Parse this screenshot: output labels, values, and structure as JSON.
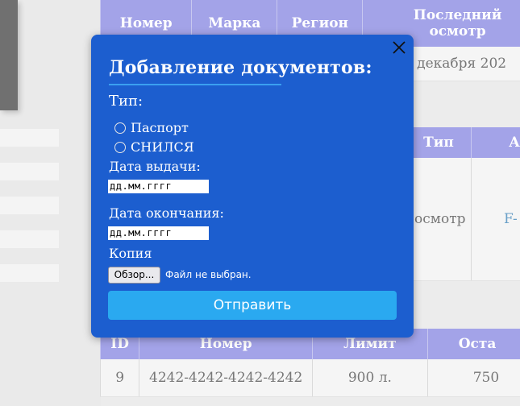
{
  "background": {
    "table1": {
      "headers": [
        "Номер",
        "Марка",
        "Регион",
        "Последний осмотр"
      ],
      "cell_date": "12 декабря 202"
    },
    "table2": {
      "headers": [
        "Тип",
        "А"
      ],
      "cell_type": "осмотр",
      "cell_link": "F-"
    },
    "table3": {
      "headers": [
        "ID",
        "Номер",
        "Лимит",
        "Оста"
      ],
      "row": [
        "9",
        "4242-4242-4242-4242",
        "900 л.",
        "750"
      ]
    }
  },
  "modal": {
    "title": "Добавление документов:",
    "type_label": "Тип:",
    "options": [
      "Паспорт",
      "СНИЛСЯ"
    ],
    "issue_date_label": "Дата выдачи:",
    "issue_date_placeholder": "дд.мм.гггг",
    "end_date_label": "Дата окончания:",
    "end_date_placeholder": "дд.мм.гггг",
    "copy_label": "Копия",
    "browse_button": "Обзор...",
    "file_status": "Файл не выбран.",
    "submit_label": "Отправить"
  },
  "colors": {
    "modal_bg": "#1c5ecf",
    "submit_bg": "#2aa9f0",
    "table_header_bg": "#a3a3e8"
  }
}
